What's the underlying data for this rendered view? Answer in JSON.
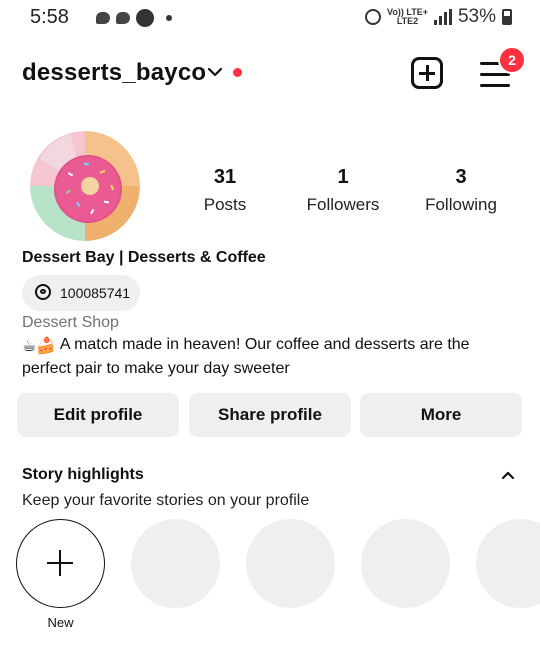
{
  "status_bar": {
    "time": "5:58",
    "network_top": "Vo)) LTE+",
    "network_bottom": "LTE2",
    "battery": "53%"
  },
  "header": {
    "username": "desserts_bayco",
    "menu_badge": "2",
    "accent_color": "#ff3040"
  },
  "profile": {
    "stats": [
      {
        "value": "31",
        "label": "Posts"
      },
      {
        "value": "1",
        "label": "Followers"
      },
      {
        "value": "3",
        "label": "Following"
      }
    ],
    "full_name": "Dessert Bay | Desserts & Coffee",
    "threads_handle": "100085741",
    "category": "Dessert Shop",
    "bio_emoji": "☕🍰",
    "bio": "A match made in heaven! Our coffee and desserts are the perfect pair to make your day sweeter"
  },
  "actions": {
    "edit": "Edit profile",
    "share": "Share profile",
    "more": "More"
  },
  "highlights": {
    "title": "Story highlights",
    "subtitle": "Keep your favorite stories on your profile",
    "new_label": "New"
  }
}
